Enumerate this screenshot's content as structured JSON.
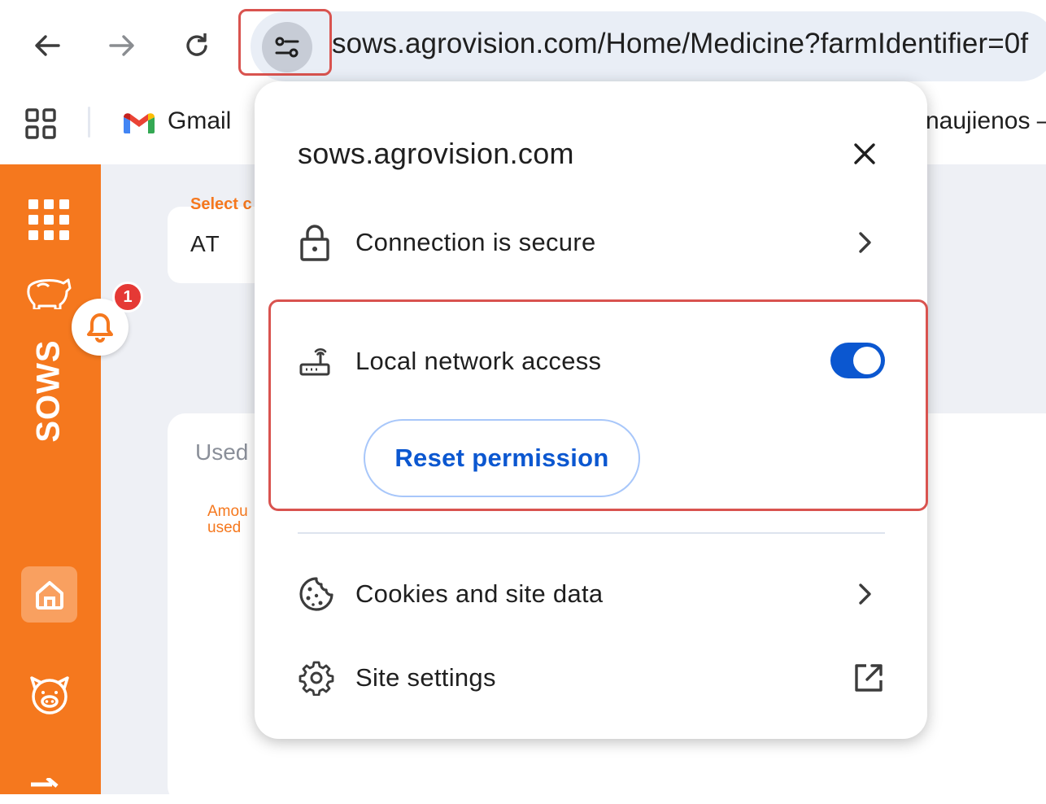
{
  "browser": {
    "url": "sows.agrovision.com/Home/Medicine?farmIdentifier=0f",
    "bookmarks": [
      {
        "label": "Gmail",
        "icon": "gmail-icon"
      },
      {
        "label": "naujienos –",
        "icon": ""
      }
    ],
    "nav_icons": [
      "back-arrow-icon",
      "forward-arrow-icon",
      "reload-icon",
      "tune-icon",
      "apps-grid-icon"
    ]
  },
  "page": {
    "brand": "SOWS",
    "select_label": "Select c",
    "select_value": "AT",
    "used_label": "Used",
    "amount_label": "Amou used",
    "notification_count": "1",
    "accent_color": "#f5781e"
  },
  "popup": {
    "site": "sows.agrovision.com",
    "connection_label": "Connection is secure",
    "local_network_label": "Local network access",
    "local_network_enabled": true,
    "reset_label": "Reset permission",
    "cookies_label": "Cookies and site data",
    "settings_label": "Site settings",
    "toggle_color": "#0b57d0",
    "highlight_color": "#d9534f"
  }
}
